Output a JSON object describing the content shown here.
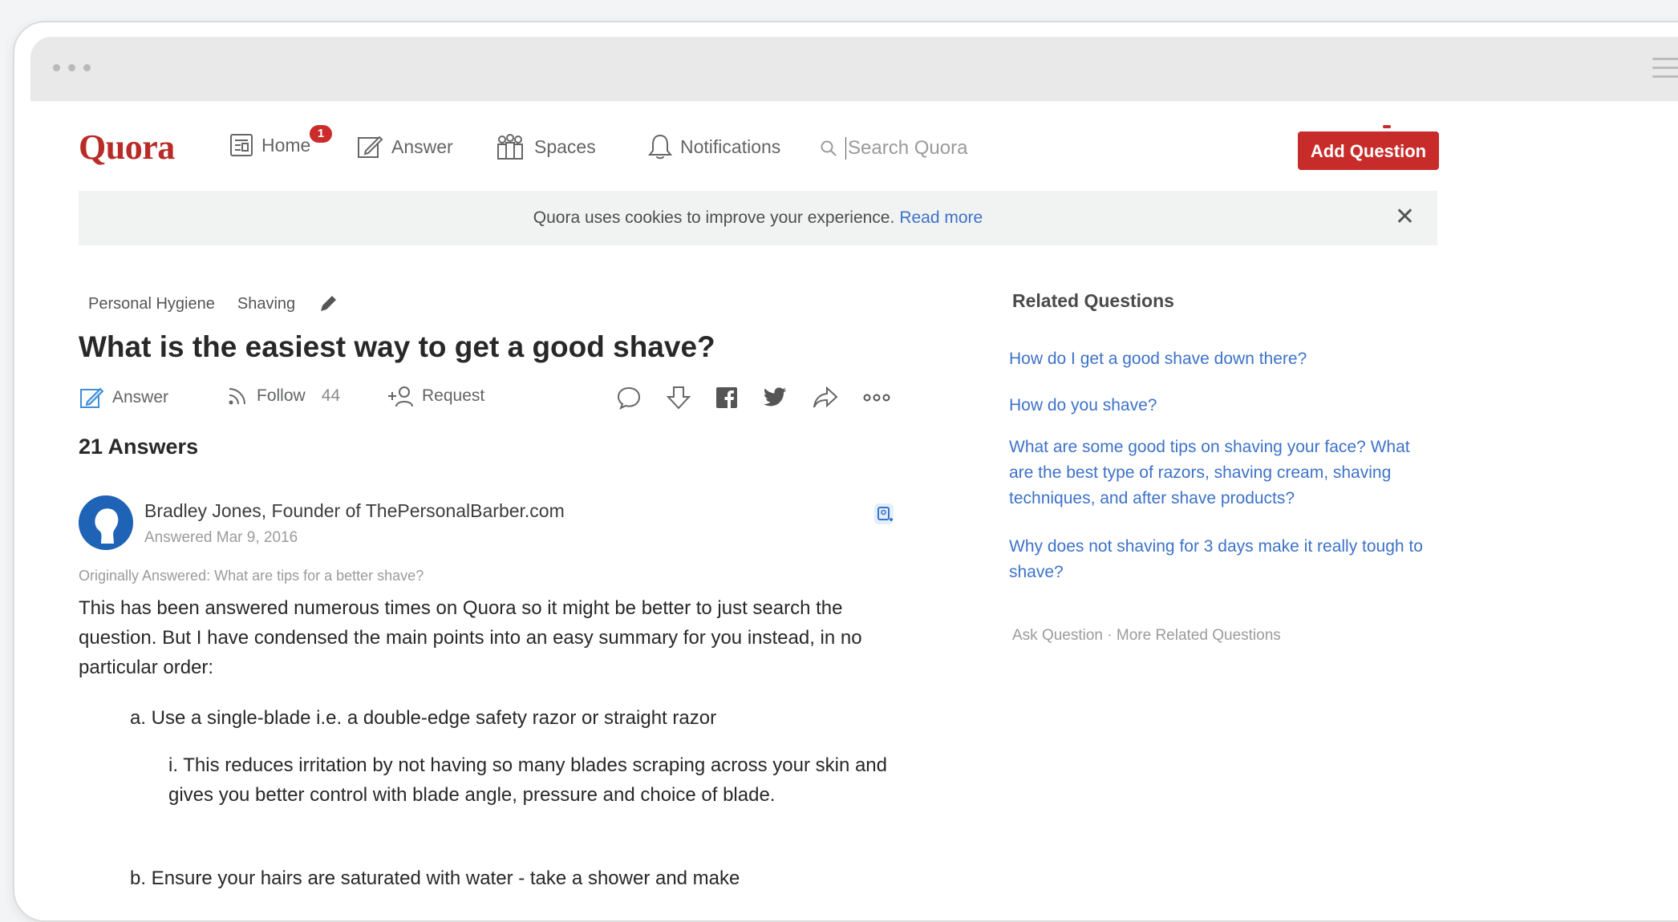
{
  "nav": {
    "logo": "Quora",
    "home": "Home",
    "home_badge": "1",
    "answer": "Answer",
    "spaces": "Spaces",
    "notifications": "Notifications",
    "search_placeholder": "Search Quora",
    "add_question": "Add Question"
  },
  "cookie": {
    "text": "Quora uses cookies to improve your experience.",
    "link": "Read more"
  },
  "question": {
    "topics": [
      "Personal Hygiene",
      "Shaving"
    ],
    "title": "What is the easiest way to get a good shave?",
    "actions": {
      "answer": "Answer",
      "follow": "Follow",
      "follow_count": "44",
      "request": "Request"
    },
    "answers_count": "21 Answers"
  },
  "answer": {
    "author": "Bradley Jones, Founder of ThePersonalBarber.com",
    "date": "Answered Mar 9, 2016",
    "originally": "Originally Answered: What are tips for a better shave?",
    "paragraph": "This has been answered numerous times on Quora so it might be better to just search the question. But I have condensed the main points into an easy summary for you instead, in no particular order:",
    "item_a": "a. Use a single-blade i.e. a double-edge safety razor or straight razor",
    "item_a_i": "i. This reduces irritation by not having so many blades scraping across your skin and gives you better control with blade angle, pressure and choice of blade.",
    "item_b": "b. Ensure your hairs are saturated with water - take a shower and make"
  },
  "related": {
    "title": "Related Questions",
    "questions": [
      "How do I get a good shave down there?",
      "How do you shave?",
      "What are some good tips on shaving your face? What are the best type of razors, shaving cream, shaving techniques, and after shave products?",
      "Why does not shaving for 3 days make it really tough to shave?"
    ],
    "footer": "Ask Question · More Related Questions"
  },
  "colors": {
    "brand": "#b92b27",
    "button": "#c82c2a",
    "link": "#3d72c9"
  }
}
